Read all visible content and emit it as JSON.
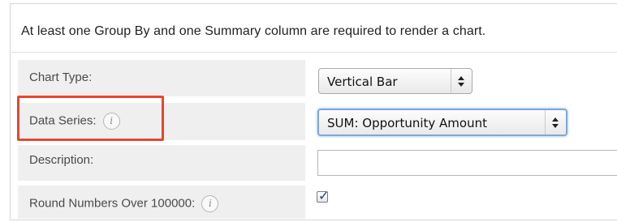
{
  "notice": "At least one Group By and one Summary column are required to render a chart.",
  "fields": {
    "chart_type": {
      "label": "Chart Type:",
      "value": "Vertical Bar"
    },
    "data_series": {
      "label": "Data Series:",
      "value": "SUM: Opportunity Amount",
      "info_icon_glyph": "i"
    },
    "description": {
      "label": "Description:",
      "value": ""
    },
    "round_numbers": {
      "label": "Round Numbers Over 100000:",
      "checked": true,
      "check_glyph": "✓",
      "info_icon_glyph": "i"
    }
  },
  "icons": {
    "info": "info-icon",
    "select_arrows": "up-down-arrows-icon",
    "checkmark": "checkmark-icon"
  },
  "colors": {
    "highlight_border": "#e8462f",
    "label_background": "#efefef",
    "focus_glow": "#7fa7d9"
  }
}
